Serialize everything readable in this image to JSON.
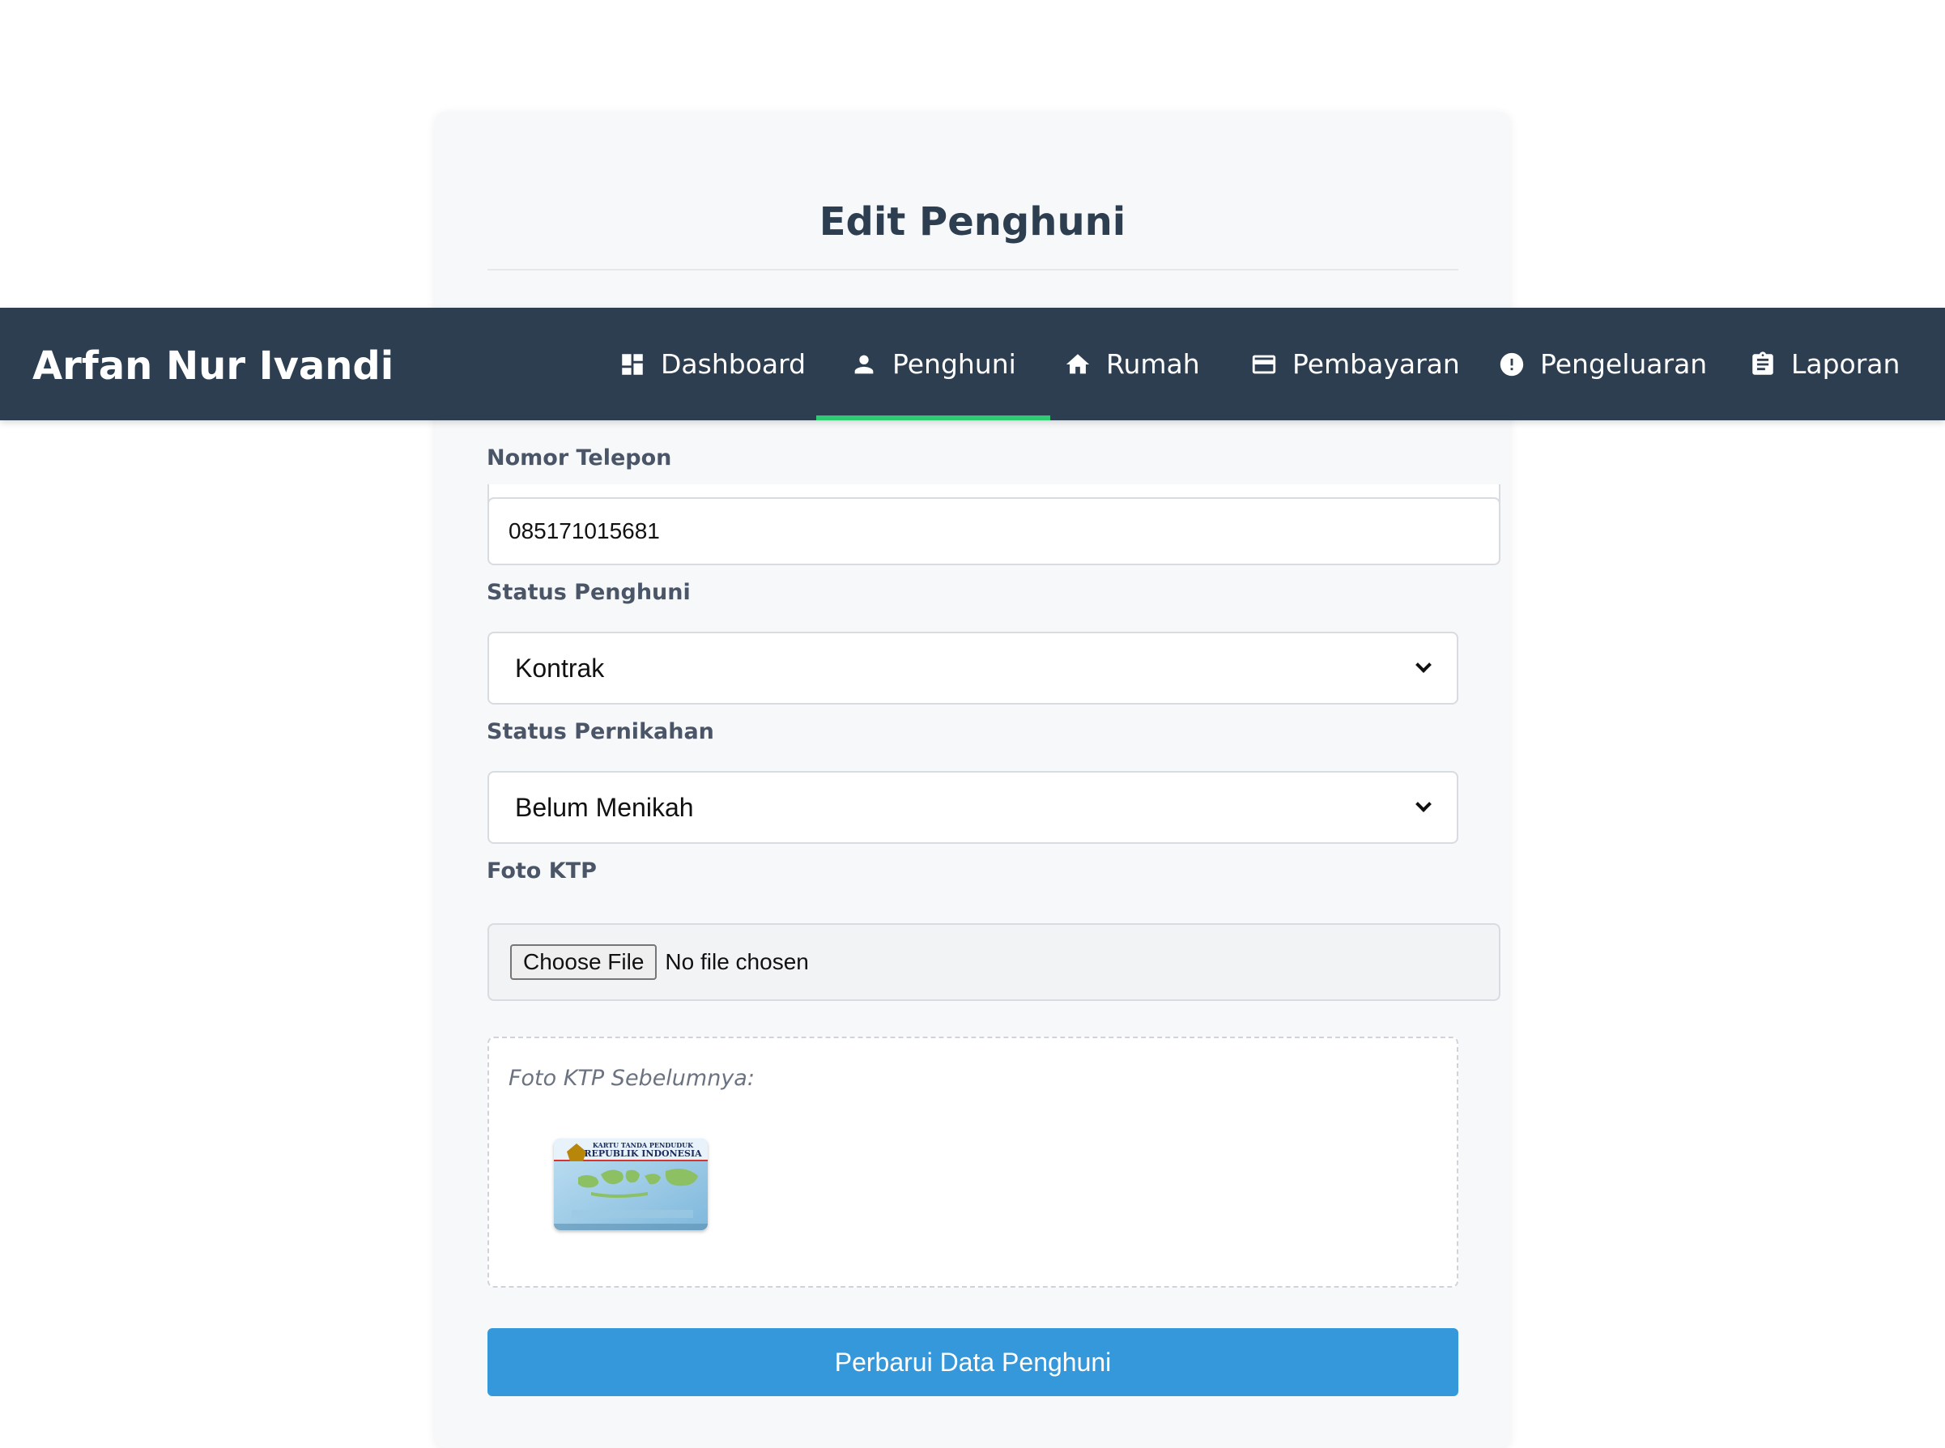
{
  "navbar": {
    "brand": "Arfan Nur Ivandi",
    "items": [
      {
        "label": "Dashboard",
        "icon": "dashboard-icon"
      },
      {
        "label": "Penghuni",
        "icon": "person-icon",
        "active": true
      },
      {
        "label": "Rumah",
        "icon": "home-icon"
      },
      {
        "label": "Pembayaran",
        "icon": "credit-card-icon"
      },
      {
        "label": "Pengeluaran",
        "icon": "alert-circle-icon"
      },
      {
        "label": "Laporan",
        "icon": "clipboard-icon"
      }
    ],
    "active_color": "#2ecc71",
    "background": "#2c3e50"
  },
  "form": {
    "title": "Edit Penghuni",
    "phone_label": "Nomor Telepon",
    "phone_value": "085171015681",
    "status_label": "Status Penghuni",
    "status_value": "Kontrak",
    "marital_label": "Status Pernikahan",
    "marital_value": "Belum Menikah",
    "ktp_label": "Foto KTP",
    "file_button": "Choose File",
    "file_status": "No file chosen",
    "previous_ktp_caption": "Foto KTP Sebelumnya:",
    "ktp_card_line1": "KARTU TANDA PENDUDUK",
    "ktp_card_line2": "REPUBLIK INDONESIA",
    "submit_label": "Perbarui Data Penghuni",
    "submit_color": "#3498db"
  }
}
